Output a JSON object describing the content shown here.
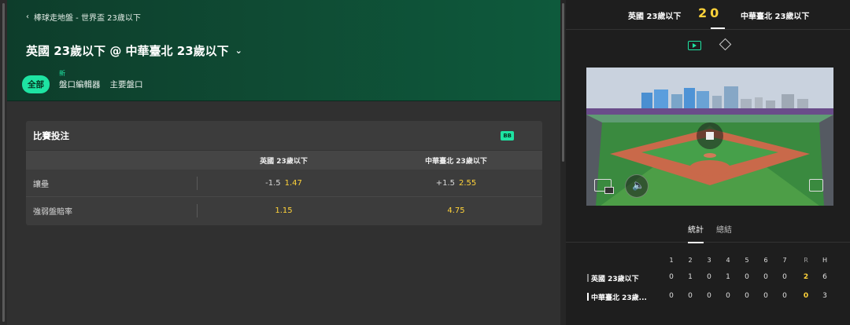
{
  "breadcrumb": {
    "text": "棒球走地盤 - 世界盃 23歲以下"
  },
  "match": {
    "title": "英國 23歲以下 @ 中華臺北 23歲以下"
  },
  "tabs": [
    {
      "label": "全部",
      "active": true
    },
    {
      "label": "盤口編輯器",
      "badge": "新"
    },
    {
      "label": "主要盤口"
    }
  ],
  "market": {
    "title": "比賽投注",
    "badge": "BB",
    "columns": [
      "英國 23歲以下",
      "中華臺北 23歲以下"
    ],
    "rows": [
      {
        "label": "讓壘",
        "home": {
          "line": "-1.5",
          "price": "1.47"
        },
        "away": {
          "line": "+1.5",
          "price": "2.55"
        }
      },
      {
        "label": "強弱盤賠率",
        "home": {
          "line": "",
          "price": "1.15"
        },
        "away": {
          "line": "",
          "price": "4.75"
        }
      }
    ]
  },
  "scoreboard": {
    "home_team": "英國 23歲以下",
    "away_team": "中華臺北 23歲以下",
    "home_score": "2",
    "away_score": "0"
  },
  "media": {
    "icons": [
      "tv-icon",
      "diamond-icon"
    ],
    "sound_icon": "🔈"
  },
  "stats_tabs": [
    "統計",
    "總結"
  ],
  "box_score": {
    "headers": [
      "1",
      "2",
      "3",
      "4",
      "5",
      "6",
      "7",
      "R",
      "H"
    ],
    "rows": [
      {
        "team": "英國 23歲以下",
        "innings": [
          "0",
          "1",
          "0",
          "1",
          "0",
          "0",
          "0"
        ],
        "r": "2",
        "h": "6"
      },
      {
        "team": "中華臺北 23歲...",
        "innings": [
          "0",
          "0",
          "0",
          "0",
          "0",
          "0",
          "0"
        ],
        "r": "0",
        "h": "3"
      }
    ]
  },
  "colors": {
    "accent": "#1ee3a2",
    "odds": "#ffd33a",
    "hero": "#0f4a33"
  }
}
